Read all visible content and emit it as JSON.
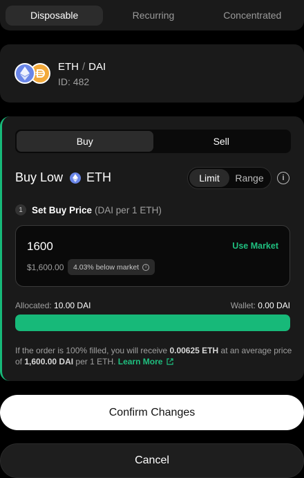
{
  "tabs": [
    {
      "label": "Disposable",
      "active": true
    },
    {
      "label": "Recurring",
      "active": false
    },
    {
      "label": "Concentrated",
      "active": false
    }
  ],
  "pair": {
    "base": "ETH",
    "separator": "/",
    "quote": "DAI",
    "id_text": "ID: 482",
    "icons": [
      "eth-icon",
      "dai-icon"
    ]
  },
  "order": {
    "side_options": [
      "Buy",
      "Sell"
    ],
    "active_side": "Buy",
    "heading_prefix": "Buy Low",
    "heading_token": "ETH",
    "mode_options": [
      "Limit",
      "Range"
    ],
    "active_mode": "Limit",
    "step_number": "1",
    "step_title": "Set Buy Price",
    "step_subtitle": "(DAI per 1 ETH)",
    "price_value": "1600",
    "use_market_label": "Use Market",
    "price_usd": "$1,600.00",
    "below_market_badge": "4.03% below market",
    "allocated_label": "Allocated:",
    "allocated_value": "10.00 DAI",
    "wallet_label": "Wallet:",
    "wallet_value": "0.00 DAI",
    "allocation_fill_fraction": 1.0,
    "summary": {
      "part1": "If the order is 100% filled, you will receive",
      "receive_amount": "0.00625 ETH",
      "part2": "at an average price of",
      "avg_price": "1,600.00 DAI",
      "part3": "per 1 ETH.",
      "learn_more": "Learn More"
    }
  },
  "actions": {
    "confirm_label": "Confirm Changes",
    "cancel_label": "Cancel"
  },
  "colors": {
    "accent_green": "#17b979",
    "background": "#000000",
    "card": "#1a1a1a"
  }
}
